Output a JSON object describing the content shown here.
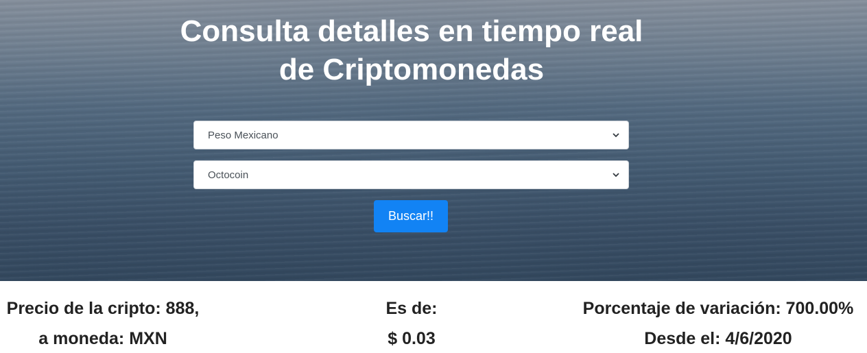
{
  "hero": {
    "title_line1": "Consulta detalles en tiempo real",
    "title_line2": "de Criptomonedas"
  },
  "form": {
    "currency_select": {
      "value": "Peso Mexicano"
    },
    "crypto_select": {
      "value": "Octocoin"
    },
    "search_button_label": "Buscar!!"
  },
  "results": {
    "price_line1": "Precio de la cripto: 888,",
    "price_line2": "a moneda: MXN",
    "value_line1": "Es de:",
    "value_line2": "$ 0.03",
    "variation_line1": "Porcentaje de variación: 700.00%",
    "variation_line2": "Desde el: 4/6/2020"
  },
  "colors": {
    "button": "#1283f4",
    "hero_top": "#858f9c",
    "hero_bottom": "#33485e",
    "text_dark": "#222222"
  },
  "icons": {
    "dropdown": "chevron-down-icon"
  }
}
